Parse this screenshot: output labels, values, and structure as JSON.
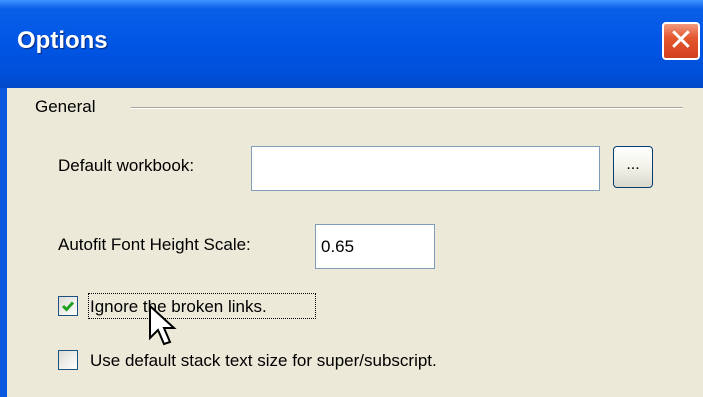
{
  "window": {
    "title": "Options",
    "close_glyph": "✕"
  },
  "general": {
    "group_label": "General",
    "default_workbook": {
      "label": "Default workbook:",
      "value": "",
      "browse_label": "..."
    },
    "autofit": {
      "label": "Autofit Font Height Scale:",
      "value": "0.65"
    },
    "ignore_broken_links": {
      "label": "Ignore the broken links.",
      "checked": true
    },
    "default_stack_text": {
      "label": "Use default stack text size for super/subscript.",
      "checked": false
    }
  },
  "icons": [
    "close-icon",
    "check-icon",
    "mouse-cursor-icon"
  ],
  "colors": {
    "titlebar": "#0055e5",
    "dialog_bg": "#ece9d8",
    "checkmark": "#21a121",
    "close_button": "#d2401c"
  }
}
